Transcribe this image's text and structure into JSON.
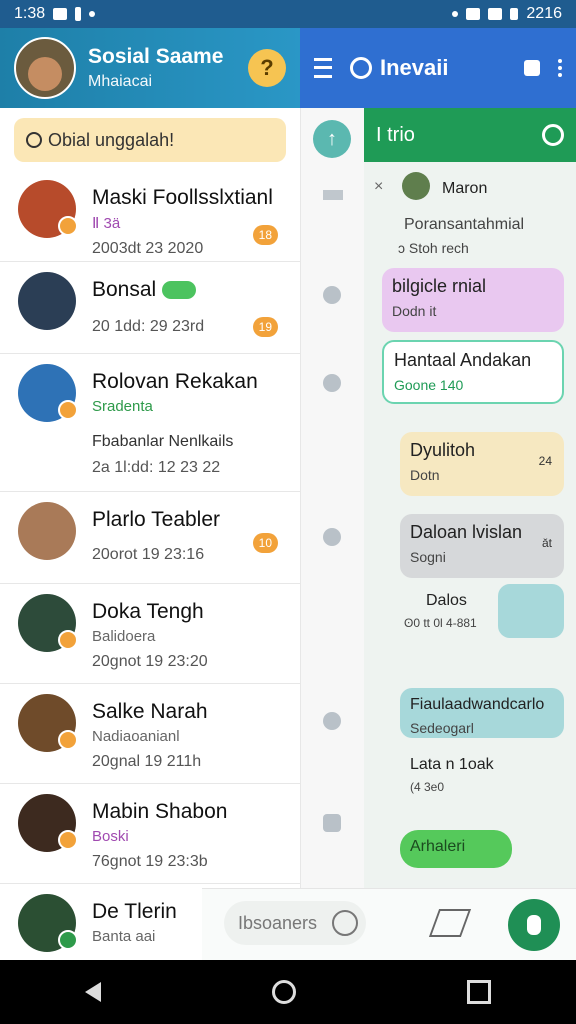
{
  "status_bar": {
    "time": "1:38",
    "battery_text": "2216"
  },
  "left_pane": {
    "profile_name": "Sosial Saame",
    "profile_subtitle": "Mhaiacai",
    "help_label": "?",
    "search_placeholder": "Obial unggalah!",
    "contacts": [
      {
        "name": "Maski Foollsslxtianl",
        "tag": "Ⅱ 3ä",
        "time": "2003dt 23 2020",
        "badge": "18"
      },
      {
        "name": "Bonsal",
        "tag": "",
        "time": "20 1dd: 29 23rd",
        "badge": "19"
      },
      {
        "name": "Rolovan Rekakan",
        "tag": "Sradenta",
        "time": "",
        "badge": "",
        "extra": "Fbabanlar Nenlkails",
        "extra_time": "2a 1l:dd: 12 23 22"
      },
      {
        "name": "Plarlo Teabler",
        "tag": "",
        "time": "20orot 19 23:16",
        "badge": "10"
      },
      {
        "name": "Doka Tengh",
        "tag": "Balidoera",
        "time": "20gnot 19 23:20",
        "badge": ""
      },
      {
        "name": "Salke Narah",
        "tag": "Nadiaoanianl",
        "time": "20gnal 19 211h",
        "badge": ""
      },
      {
        "name": "Mabin Shabon",
        "tag": "Boski",
        "time": "76gnot 19 23:3b",
        "badge": ""
      },
      {
        "name": "De Tlerin",
        "tag": "Banta aai",
        "time": "",
        "badge": ""
      }
    ]
  },
  "right_header": {
    "title": "Inevaii"
  },
  "chat": {
    "header_title": "I trio",
    "sender": "Maron",
    "line1": "Poransantahmial",
    "line2": "ɔ Stoh rech",
    "bubbles": [
      {
        "title": "bilgicle rnial",
        "sub": "Dodn it"
      },
      {
        "title": "Hantaal Andakan",
        "sub": "Goone 140"
      },
      {
        "title": "Dyulitoh",
        "sub": "Dotn",
        "time": "24"
      },
      {
        "title": "Daloan lvislan",
        "sub": "Sogni",
        "time": "ǎt"
      },
      {
        "title": "Dalos",
        "sub": "ʘ0 tt 0l 4-881"
      },
      {
        "title": "Fiaulaadwandcarlo",
        "sub": "Sedeogarl"
      },
      {
        "title": "Lata n 1oak",
        "sub": "(4 3e0"
      },
      {
        "title": "Arhaleri",
        "sub": ""
      }
    ]
  },
  "input": {
    "placeholder": "Ibsoaners"
  }
}
